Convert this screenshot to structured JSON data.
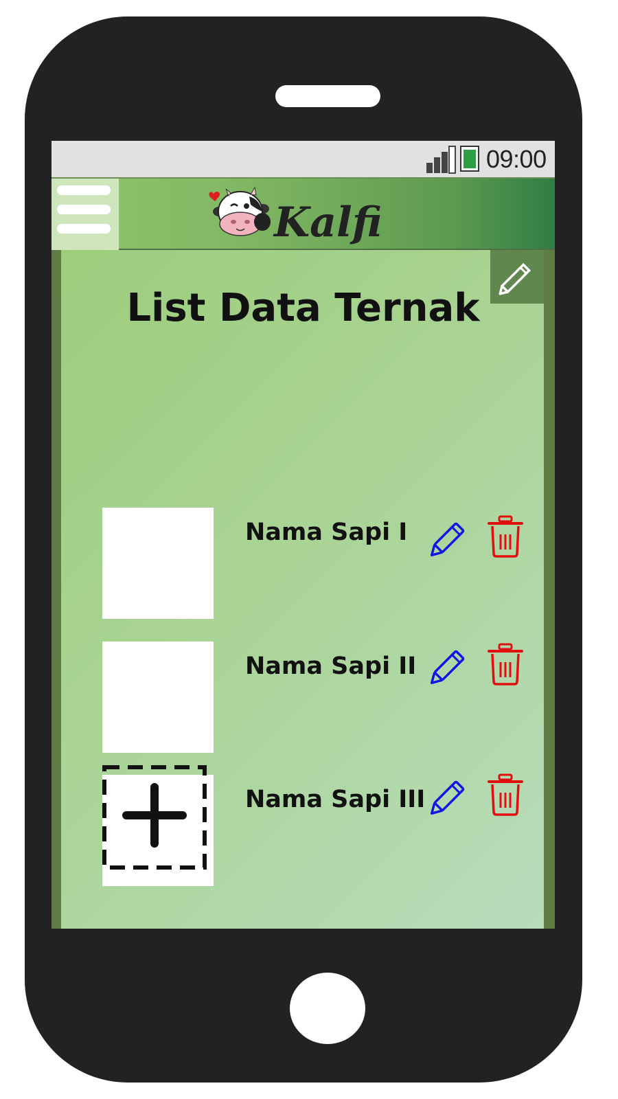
{
  "status_bar": {
    "time": "09:00"
  },
  "header": {
    "logo_text": "Kalfi",
    "menu_icon": "hamburger-menu-icon"
  },
  "main": {
    "title": "List Data Ternak",
    "corner_edit_icon": "pencil-icon",
    "items": [
      {
        "name": "Nama Sapi I"
      },
      {
        "name": "Nama Sapi II"
      },
      {
        "name": "Nama Sapi III"
      }
    ],
    "add_icon": "plus-icon"
  },
  "colors": {
    "edit": "#1414e6",
    "delete": "#e01010",
    "header_light": "#8fc46c",
    "header_dark": "#2f7d45"
  }
}
